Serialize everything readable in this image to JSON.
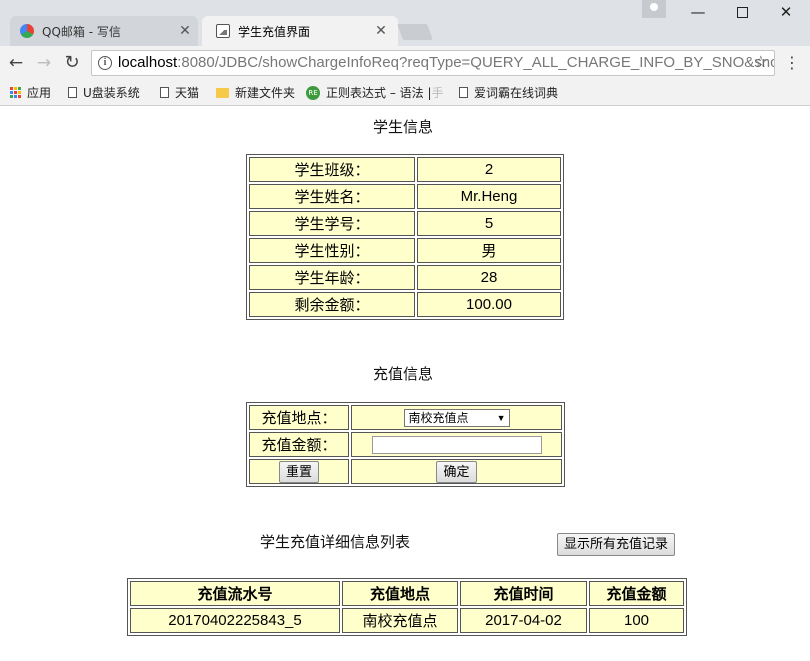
{
  "browser": {
    "tabs": [
      {
        "title": "QQ邮箱 - 写信",
        "close": "✕"
      },
      {
        "title": "学生充值界面",
        "close": "✕"
      }
    ],
    "url_host": "localhost",
    "url_rest": ":8080/JDBC/showChargeInfoReq?reqType=QUERY_ALL_CHARGE_INFO_BY_SNO&snc",
    "bookmarks": {
      "apps": "应用",
      "u_disk": "U盘装系统",
      "tmall": "天猫",
      "new_folder": "新建文件夹",
      "regex_main": "正则表达式 – 语法 |",
      "regex_fade": " 手",
      "iciba": "爱词霸在线词典"
    },
    "icons": {
      "back": "back-arrow-icon",
      "forward": "forward-arrow-icon",
      "reload": "reload-icon",
      "info": "info-icon",
      "star": "star-icon",
      "menu": "kebab-menu-icon"
    }
  },
  "student": {
    "title": "学生信息",
    "rows": [
      {
        "label": "学生班级：",
        "value": "2"
      },
      {
        "label": "学生姓名：",
        "value": "Mr.Heng"
      },
      {
        "label": "学生学号：",
        "value": "5"
      },
      {
        "label": "学生性别：",
        "value": "男"
      },
      {
        "label": "学生年龄：",
        "value": "28"
      },
      {
        "label": "剩余金额：",
        "value": "100.00"
      }
    ]
  },
  "charge": {
    "title": "充值信息",
    "location_label": "充值地点：",
    "location_selected": "南校充值点",
    "amount_label": "充值金额：",
    "amount_value": "",
    "reset_label": "重置",
    "confirm_label": "确定"
  },
  "records": {
    "title": "学生充值详细信息列表",
    "show_all_label": "显示所有充值记录",
    "headers": [
      "充值流水号",
      "充值地点",
      "充值时间",
      "充值金额"
    ],
    "rows": [
      [
        "20170402225843_5",
        "南校充值点",
        "2017-04-02",
        "100"
      ]
    ]
  },
  "colors": {
    "cell_bg": "#ffffcc",
    "chrome_bg": "#dee1e6",
    "toolbar_bg": "#f2f2f2"
  }
}
